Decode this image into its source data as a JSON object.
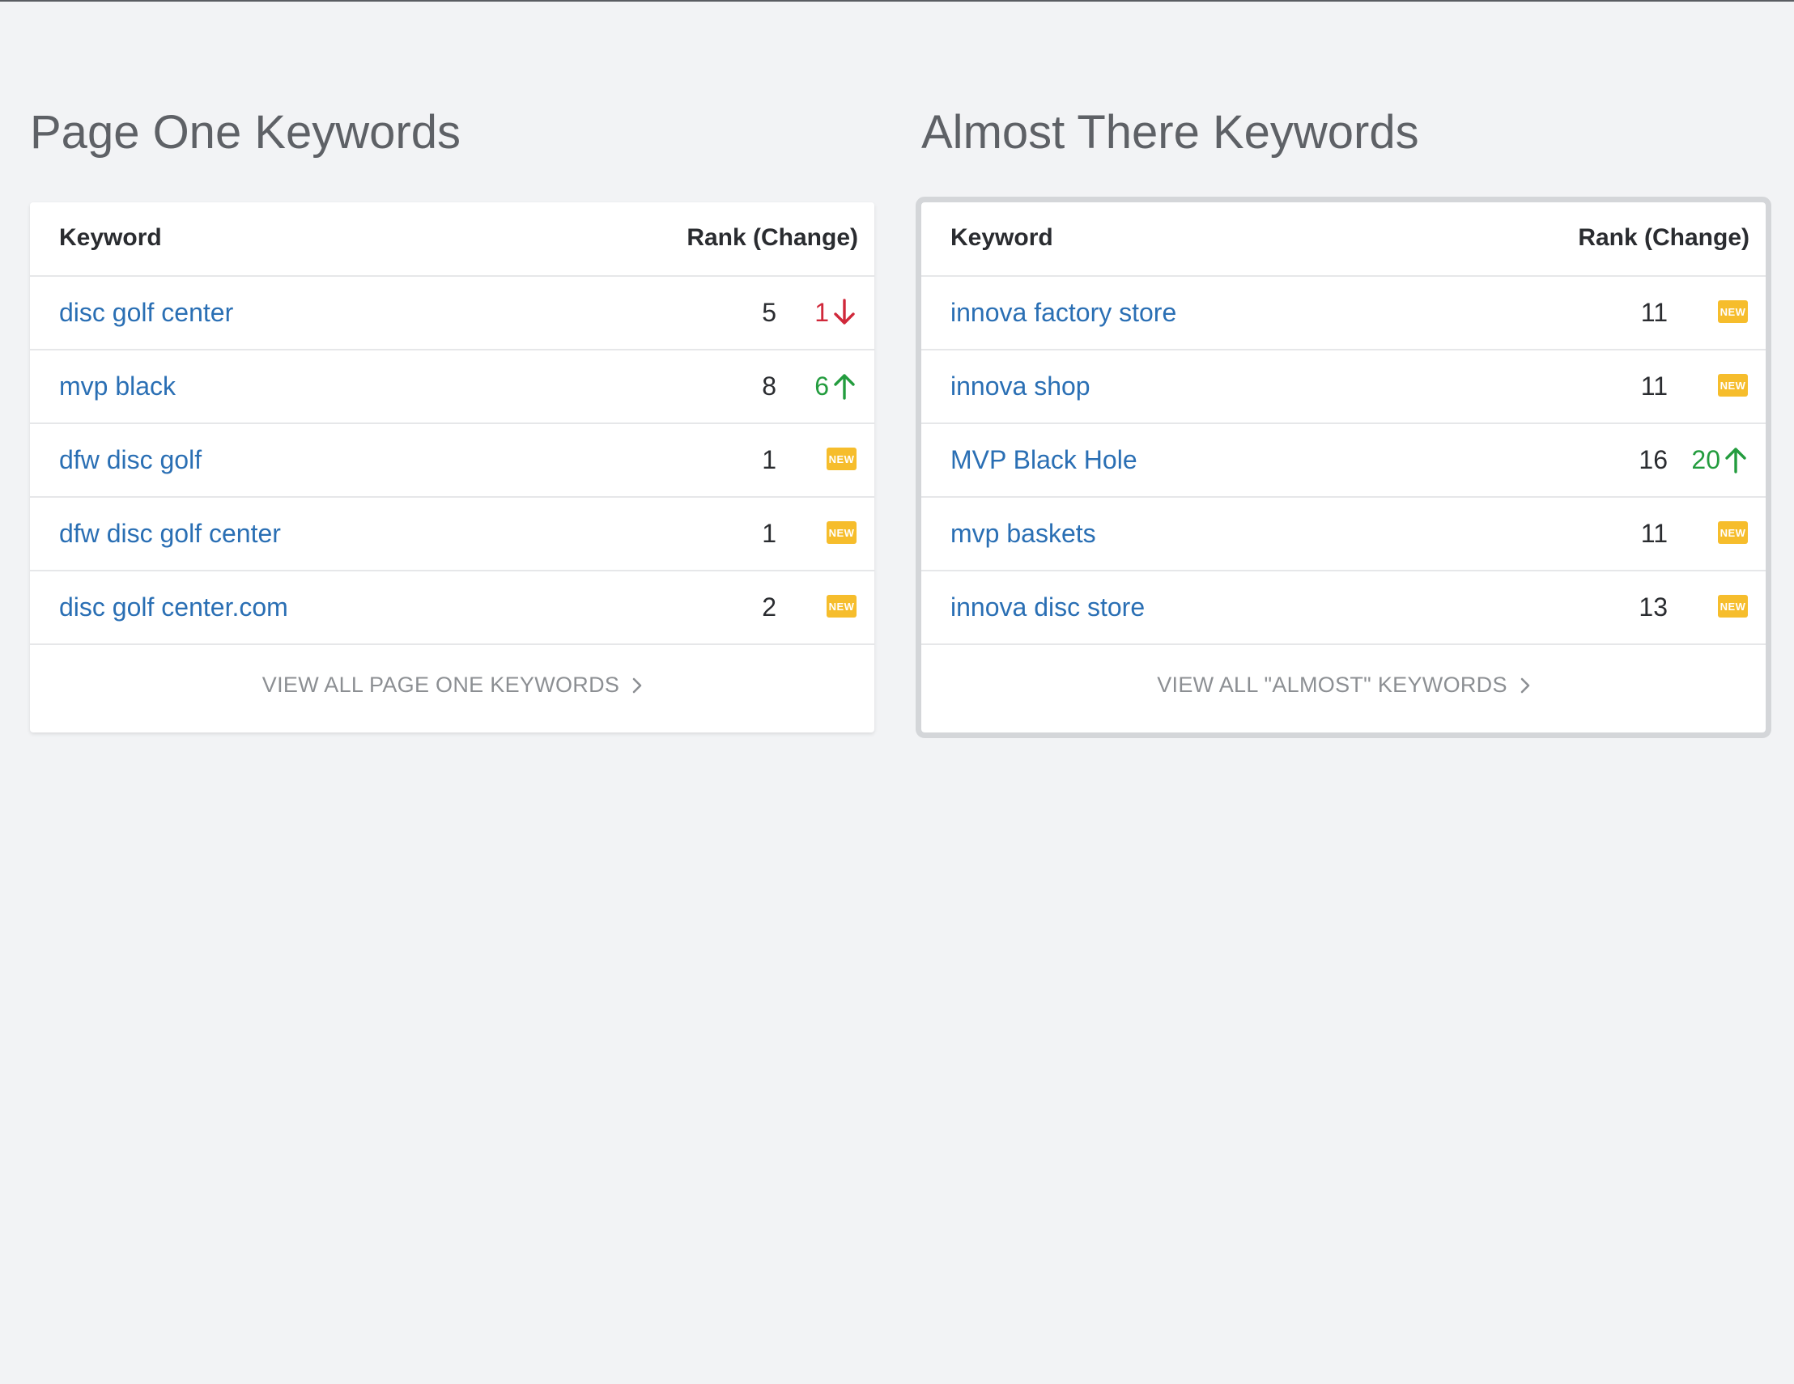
{
  "page_one": {
    "title": "Page One Keywords",
    "header_keyword": "Keyword",
    "header_rank": "Rank (Change)",
    "rows": [
      {
        "keyword": "disc golf center",
        "rank": "5",
        "change": "1",
        "change_dir": "down"
      },
      {
        "keyword": "mvp black",
        "rank": "8",
        "change": "6",
        "change_dir": "up"
      },
      {
        "keyword": "dfw disc golf",
        "rank": "1",
        "badge": "NEW"
      },
      {
        "keyword": "dfw disc golf center",
        "rank": "1",
        "badge": "NEW"
      },
      {
        "keyword": "disc golf center.com",
        "rank": "2",
        "badge": "NEW"
      }
    ],
    "footer_label": "VIEW ALL PAGE ONE KEYWORDS"
  },
  "almost_there": {
    "title": "Almost There Keywords",
    "header_keyword": "Keyword",
    "header_rank": "Rank (Change)",
    "rows": [
      {
        "keyword": "innova factory store",
        "rank": "11",
        "badge": "NEW"
      },
      {
        "keyword": "innova shop",
        "rank": "11",
        "badge": "NEW"
      },
      {
        "keyword": "MVP Black Hole",
        "rank": "16",
        "change": "20",
        "change_dir": "up"
      },
      {
        "keyword": "mvp baskets",
        "rank": "11",
        "badge": "NEW"
      },
      {
        "keyword": "innova disc store",
        "rank": "13",
        "badge": "NEW"
      }
    ],
    "footer_label": "VIEW ALL \"ALMOST\" KEYWORDS"
  },
  "colors": {
    "link": "#2a6fb4",
    "down": "#d0283a",
    "up": "#239c3e",
    "new_badge": "#f6bd2c",
    "background": "#f2f3f5"
  },
  "icons": {
    "down": "arrow-down-icon",
    "up": "arrow-up-icon",
    "footer": "chevron-right-icon"
  }
}
